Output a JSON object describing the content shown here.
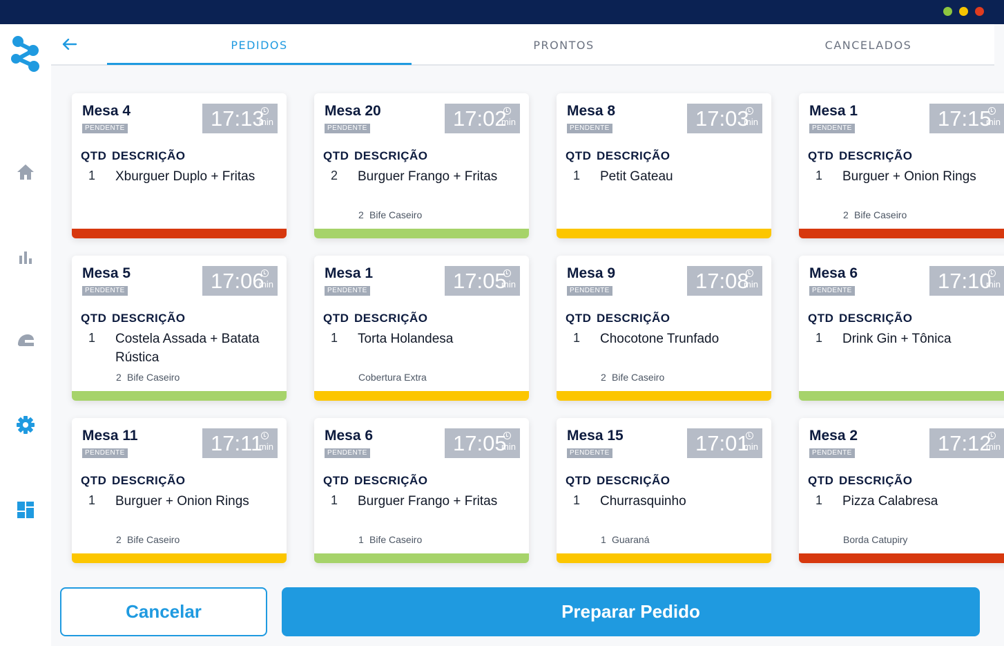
{
  "window": {
    "controls": [
      {
        "name": "green",
        "color": "#8dc63f"
      },
      {
        "name": "yellow",
        "color": "#f5c400"
      },
      {
        "name": "red",
        "color": "#e03c1f"
      }
    ]
  },
  "sidebar": {
    "logo_icon": "network-logo-icon",
    "items": [
      {
        "icon": "home-icon"
      },
      {
        "icon": "bar-chart-icon"
      },
      {
        "icon": "delivery-helmet-icon"
      },
      {
        "icon": "gear-icon"
      },
      {
        "icon": "dashboard-icon"
      }
    ]
  },
  "tabs": {
    "back_icon": "arrow-left-icon",
    "items": [
      {
        "label": "PEDIDOS",
        "active": true
      },
      {
        "label": "PRONTOS",
        "active": false
      },
      {
        "label": "CANCELADOS",
        "active": false
      }
    ]
  },
  "columns": {
    "qty": "QTD",
    "desc": "DESCRIÇÃO"
  },
  "status_colors": {
    "red": "#d7380e",
    "green": "#a6d36a",
    "yellow": "#fcc600"
  },
  "orders": [
    {
      "title": "Mesa 4",
      "status": "PENDENTE",
      "time": "17:13",
      "unit": "min",
      "qty": "1",
      "item": "Xburguer Duplo + Fritas",
      "extra_qty": "",
      "extra": "",
      "bar": "red"
    },
    {
      "title": "Mesa 20",
      "status": "PENDENTE",
      "time": "17:02",
      "unit": "min",
      "qty": "2",
      "item": "Burguer Frango + Fritas",
      "extra_qty": "2",
      "extra": "Bife Caseiro",
      "bar": "green"
    },
    {
      "title": "Mesa 8",
      "status": "PENDENTE",
      "time": "17:03",
      "unit": "min",
      "qty": "1",
      "item": "Petit Gateau",
      "extra_qty": "",
      "extra": "",
      "bar": "yellow"
    },
    {
      "title": "Mesa 1",
      "status": "PENDENTE",
      "time": "17:15",
      "unit": "min",
      "qty": "1",
      "item": "Burguer + Onion Rings",
      "extra_qty": "2",
      "extra": "Bife Caseiro",
      "bar": "red"
    },
    {
      "title": "Mesa 5",
      "status": "PENDENTE",
      "time": "17:06",
      "unit": "min",
      "qty": "1",
      "item": "Costela Assada + Batata Rústica",
      "extra_qty": "2",
      "extra": "Bife Caseiro",
      "bar": "green"
    },
    {
      "title": "Mesa 1",
      "status": "PENDENTE",
      "time": "17:05",
      "unit": "min",
      "qty": "1",
      "item": "Torta Holandesa",
      "extra_qty": "",
      "extra": "Cobertura Extra",
      "bar": "yellow"
    },
    {
      "title": "Mesa 9",
      "status": "PENDENTE",
      "time": "17:08",
      "unit": "min",
      "qty": "1",
      "item": "Chocotone Trunfado",
      "extra_qty": "2",
      "extra": "Bife Caseiro",
      "bar": "yellow"
    },
    {
      "title": "Mesa 6",
      "status": "PENDENTE",
      "time": "17:10",
      "unit": "min",
      "qty": "1",
      "item": "Drink Gin + Tônica",
      "extra_qty": "",
      "extra": "",
      "bar": "green"
    },
    {
      "title": "Mesa 11",
      "status": "PENDENTE",
      "time": "17:11",
      "unit": "min",
      "qty": "1",
      "item": "Burguer + Onion Rings",
      "extra_qty": "2",
      "extra": "Bife Caseiro",
      "bar": "yellow"
    },
    {
      "title": "Mesa 6",
      "status": "PENDENTE",
      "time": "17:05",
      "unit": "min",
      "qty": "1",
      "item": "Burguer Frango + Fritas",
      "extra_qty": "1",
      "extra": "Bife Caseiro",
      "bar": "green"
    },
    {
      "title": "Mesa 15",
      "status": "PENDENTE",
      "time": "17:01",
      "unit": "min",
      "qty": "1",
      "item": "Churrasquinho",
      "extra_qty": "1",
      "extra": "Guaraná",
      "bar": "yellow"
    },
    {
      "title": "Mesa 2",
      "status": "PENDENTE",
      "time": "17:12",
      "unit": "min",
      "qty": "1",
      "item": "Pizza Calabresa",
      "extra_qty": "",
      "extra": "Borda Catupiry",
      "bar": "red"
    }
  ],
  "actions": {
    "cancel": "Cancelar",
    "prepare": "Preparar Pedido"
  }
}
